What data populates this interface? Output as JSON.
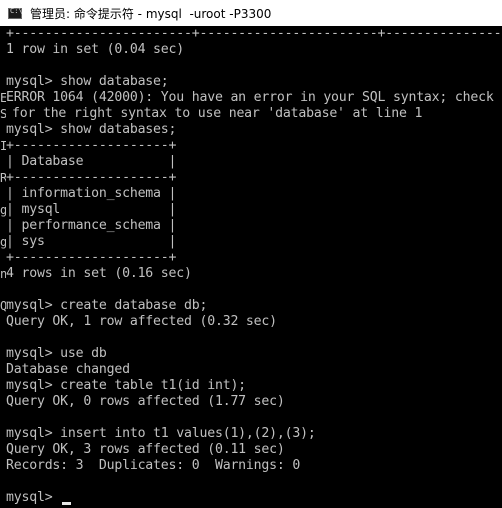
{
  "window": {
    "title": "管理员: 命令提示符 - mysql  -uroot -P3300",
    "icon": "cmd-icon"
  },
  "terminal": {
    "fg_color": "#c0c0c0",
    "bg_color": "#000000",
    "lines": [
      "+-----------------------+-----------------------+-------------------+",
      "1 row in set (0.04 sec)",
      "",
      "mysql> show database;",
      "ERROR 1064 (42000): You have an error in your SQL syntax; check",
      "for the right syntax to use near 'database' at line 1",
      "mysql> show databases;",
      "+--------------------+",
      "| Database           |",
      "+--------------------+",
      "| information_schema |",
      "| mysql              |",
      "| performance_schema |",
      "| sys                |",
      "+--------------------+",
      "4 rows in set (0.16 sec)",
      "",
      "mysql> create database db;",
      "Query OK, 1 row affected (0.32 sec)",
      "",
      "mysql> use db",
      "Database changed",
      "mysql> create table t1(id int);",
      "Query OK, 0 rows affected (1.77 sec)",
      "",
      "mysql> insert into t1 values(1),(2),(3);",
      "Query OK, 3 rows affected (0.11 sec)",
      "Records: 3  Duplicates: 0  Warnings: 0",
      "",
      "mysql> "
    ],
    "edge_artifacts": [
      "",
      "",
      "",
      "",
      "E",
      "S",
      "",
      "I",
      "",
      "R",
      "",
      "g",
      "",
      "g",
      "",
      "n",
      "",
      "",
      "Q",
      "",
      "",
      "",
      "",
      "",
      "",
      "",
      "",
      "",
      "",
      ""
    ]
  }
}
